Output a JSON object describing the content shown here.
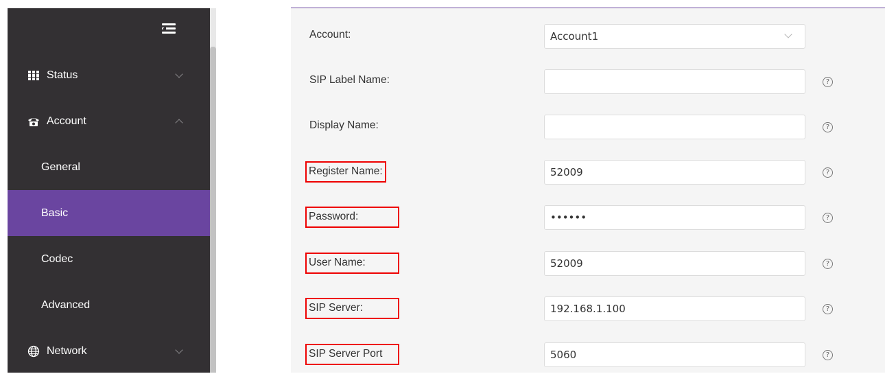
{
  "sidebar": {
    "items": [
      {
        "label": "Status",
        "icon": "grid-icon",
        "expanded": false
      },
      {
        "label": "Account",
        "icon": "phone-icon",
        "expanded": true
      },
      {
        "label": "General"
      },
      {
        "label": "Basic",
        "active": true
      },
      {
        "label": "Codec"
      },
      {
        "label": "Advanced"
      },
      {
        "label": "Network",
        "icon": "globe-icon",
        "expanded": false
      }
    ],
    "colors": {
      "background": "#333033",
      "active": "#6a45a0"
    }
  },
  "form": {
    "fields": [
      {
        "label": "Account:",
        "value": "Account1",
        "type": "select"
      },
      {
        "label": "SIP Label Name:",
        "value": ""
      },
      {
        "label": "Display Name:",
        "value": ""
      },
      {
        "label": "Register Name:",
        "value": "52009",
        "highlighted": true
      },
      {
        "label": "Password:",
        "value": "••••••",
        "highlighted": true
      },
      {
        "label": "User Name:",
        "value": "52009",
        "highlighted": true
      },
      {
        "label": "SIP Server:",
        "value": "192.168.1.100",
        "highlighted": true
      },
      {
        "label": "SIP Server Port",
        "value": "5060",
        "highlighted": true
      }
    ],
    "help_symbol": "?",
    "highlight_color": "#e00000"
  }
}
